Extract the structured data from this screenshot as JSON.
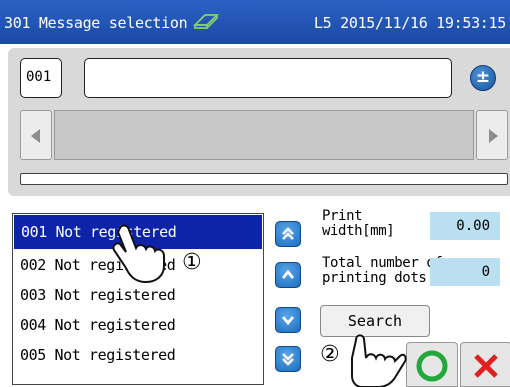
{
  "title_bar": {
    "title": "301 Message selection",
    "status": "L5 2015/11/16 19:53:15",
    "eraser_icon": "eraser-icon"
  },
  "message_edit": {
    "number_value": "001",
    "name_value": "",
    "plus_minus_label": "±"
  },
  "message_list": {
    "items": [
      "001 Not registered",
      "002 Not registered",
      "003 Not registered",
      "004 Not registered",
      "005 Not registered"
    ],
    "selected_index": 0
  },
  "scroll_buttons": [
    "page-up-icon",
    "up-icon",
    "down-icon",
    "page-down-icon"
  ],
  "info": {
    "print_width_label": "Print\nwidth[mm]",
    "print_width_value": "0.00",
    "dots_label": "Total number of\nprinting dots",
    "dots_value": "0"
  },
  "search_button": "Search",
  "annotations": {
    "marker1": "①",
    "marker2": "②"
  },
  "colors": {
    "title_bar": "#1a49a6",
    "selection": "#0d24a8",
    "info_value_bg": "#b9dff1",
    "ok_green": "#22a83a",
    "cancel_red": "#e02020"
  }
}
